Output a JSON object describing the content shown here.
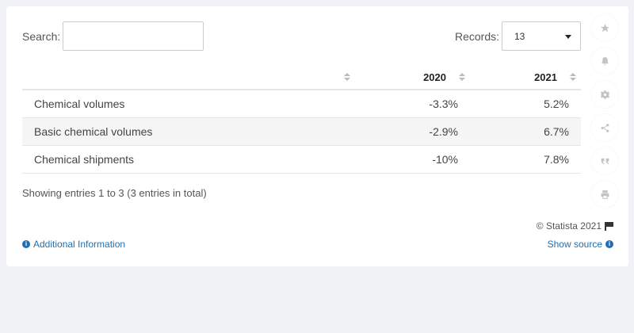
{
  "search": {
    "label": "Search:",
    "value": ""
  },
  "records": {
    "label": "Records:",
    "value": "13"
  },
  "table": {
    "headers": [
      "",
      "2020",
      "2021"
    ],
    "rows": [
      {
        "name": "Chemical volumes",
        "v2020": "-3.3%",
        "v2021": "5.2%"
      },
      {
        "name": "Basic chemical volumes",
        "v2020": "-2.9%",
        "v2021": "6.7%"
      },
      {
        "name": "Chemical shipments",
        "v2020": "-10%",
        "v2021": "7.8%"
      }
    ]
  },
  "footer": {
    "showing": "Showing entries 1 to 3 (3 entries in total)",
    "copyright": "© Statista 2021",
    "additional_info": "Additional Information",
    "show_source": "Show source"
  },
  "sidebar_icons": [
    "star-icon",
    "bell-icon",
    "gear-icon",
    "share-icon",
    "quote-icon",
    "print-icon"
  ]
}
